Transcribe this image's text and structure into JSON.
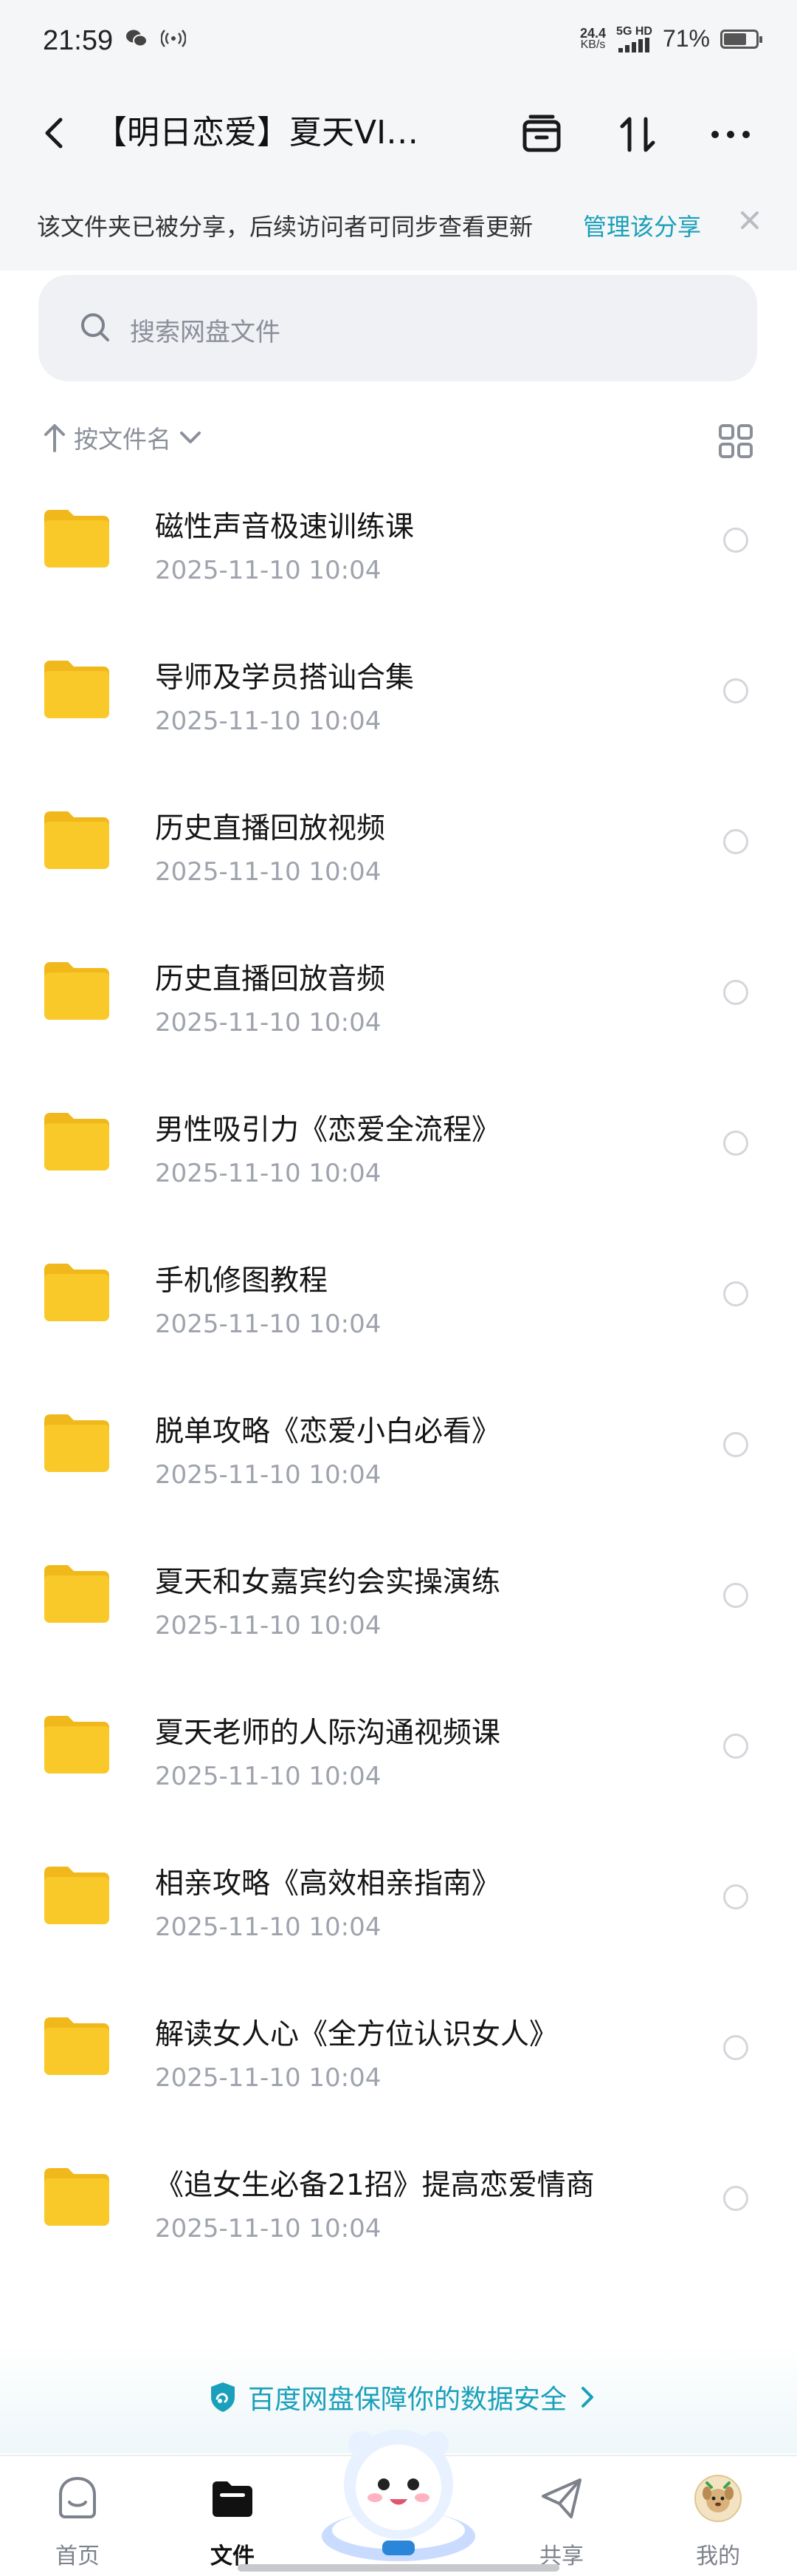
{
  "status": {
    "time": "21:59",
    "net_speed_value": "24.4",
    "net_speed_unit": "KB/s",
    "network": "5G HD",
    "battery": "71%",
    "battery_level": 0.71
  },
  "header": {
    "title": "【明日恋爱】夏天VI…"
  },
  "share_notice": {
    "text": "该文件夹已被分享，后续访问者可同步查看更新",
    "manage_label": "管理该分享"
  },
  "search": {
    "placeholder": "搜索网盘文件"
  },
  "sort": {
    "label": "按文件名"
  },
  "files": [
    {
      "name": "磁性声音极速训练课",
      "date": "2025-11-10  10:04",
      "icon": "folder-icon"
    },
    {
      "name": "导师及学员搭讪合集",
      "date": "2025-11-10  10:04",
      "icon": "folder-icon"
    },
    {
      "name": "历史直播回放视频",
      "date": "2025-11-10  10:04",
      "icon": "folder-icon"
    },
    {
      "name": "历史直播回放音频",
      "date": "2025-11-10  10:04",
      "icon": "folder-icon"
    },
    {
      "name": "男性吸引力《恋爱全流程》",
      "date": "2025-11-10  10:04",
      "icon": "folder-icon"
    },
    {
      "name": "手机修图教程",
      "date": "2025-11-10  10:04",
      "icon": "folder-icon"
    },
    {
      "name": "脱单攻略《恋爱小白必看》",
      "date": "2025-11-10  10:04",
      "icon": "folder-icon"
    },
    {
      "name": "夏天和女嘉宾约会实操演练",
      "date": "2025-11-10  10:04",
      "icon": "folder-icon"
    },
    {
      "name": "夏天老师的人际沟通视频课",
      "date": "2025-11-10  10:04",
      "icon": "folder-icon"
    },
    {
      "name": "相亲攻略《高效相亲指南》",
      "date": "2025-11-10  10:04",
      "icon": "folder-icon"
    },
    {
      "name": "解读女人心《全方位认识女人》",
      "date": "2025-11-10  10:04",
      "icon": "folder-icon"
    },
    {
      "name": "《追女生必备21招》提高恋爱情商",
      "date": "2025-11-10  10:04",
      "icon": "folder-icon"
    }
  ],
  "safety": {
    "text": "百度网盘保障你的数据安全"
  },
  "nav": {
    "home": "首页",
    "files": "文件",
    "share": "共享",
    "me": "我的",
    "active": "files"
  },
  "colors": {
    "accent": "#1aa0ba",
    "folder": "#f8c928",
    "folder_dark": "#f1b81c",
    "muted": "#9ea3ad",
    "page_bg": "#f5f6f8"
  }
}
